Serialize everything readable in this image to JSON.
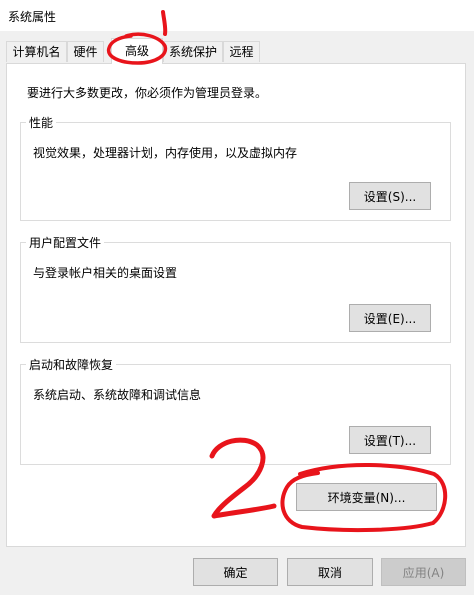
{
  "window": {
    "title": "系统属性"
  },
  "tabs": [
    {
      "label": "计算机名"
    },
    {
      "label": "硬件"
    },
    {
      "label": "高级"
    },
    {
      "label": "系统保护"
    },
    {
      "label": "远程"
    }
  ],
  "admin_notice": "要进行大多数更改，你必须作为管理员登录。",
  "performance": {
    "title": "性能",
    "description": "视觉效果，处理器计划，内存使用，以及虚拟内存",
    "button": "设置(S)..."
  },
  "user_profiles": {
    "title": "用户配置文件",
    "description": "与登录帐户相关的桌面设置",
    "button": "设置(E)..."
  },
  "startup_recovery": {
    "title": "启动和故障恢复",
    "description": "系统启动、系统故障和调试信息",
    "button": "设置(T)..."
  },
  "env_button": "环境变量(N)...",
  "footer": {
    "ok": "确定",
    "cancel": "取消",
    "apply": "应用(A)"
  },
  "annotation_color": "#e8141b"
}
